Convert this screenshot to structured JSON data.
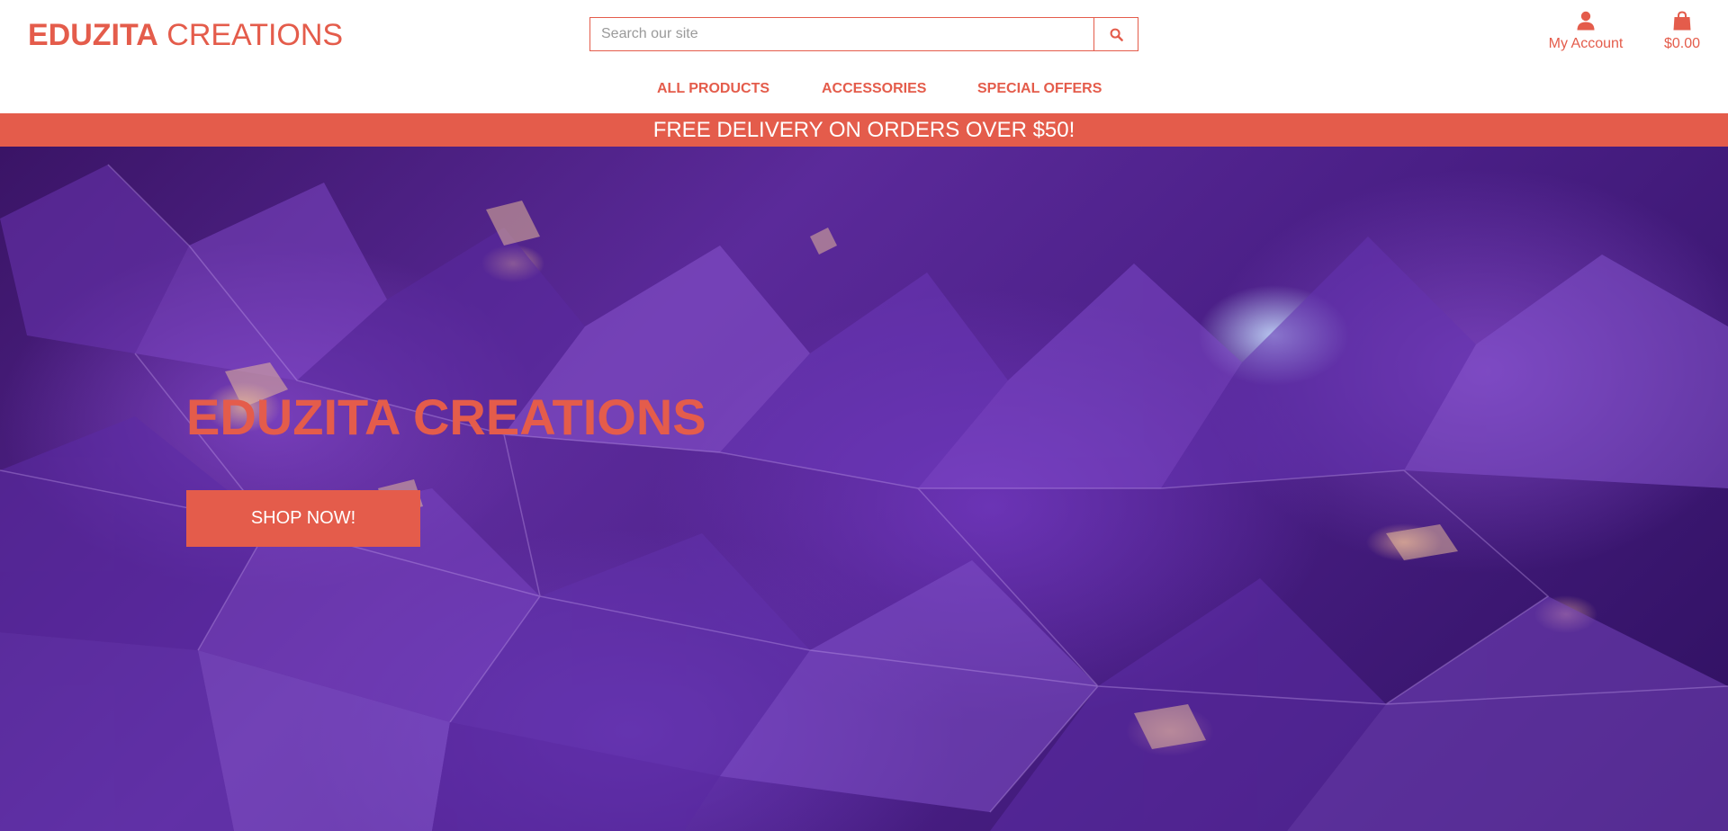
{
  "brand": {
    "name_bold": "EDUZITA",
    "name_regular": "CREATIONS",
    "accent_color": "#e45c4b"
  },
  "search": {
    "placeholder": "Search our site",
    "value": "",
    "icon": "search-icon"
  },
  "account": {
    "label": "My Account",
    "icon": "user-icon"
  },
  "cart": {
    "total": "$0.00",
    "icon": "shopping-bag-icon"
  },
  "nav": {
    "items": [
      {
        "label": "ALL PRODUCTS"
      },
      {
        "label": "ACCESSORIES"
      },
      {
        "label": "SPECIAL OFFERS"
      }
    ]
  },
  "promo": {
    "text": "FREE DELIVERY ON ORDERS OVER $50!"
  },
  "hero": {
    "title": "EDUZITA CREATIONS",
    "cta_label": "SHOP NOW!",
    "background": "amethyst crystal photo"
  }
}
